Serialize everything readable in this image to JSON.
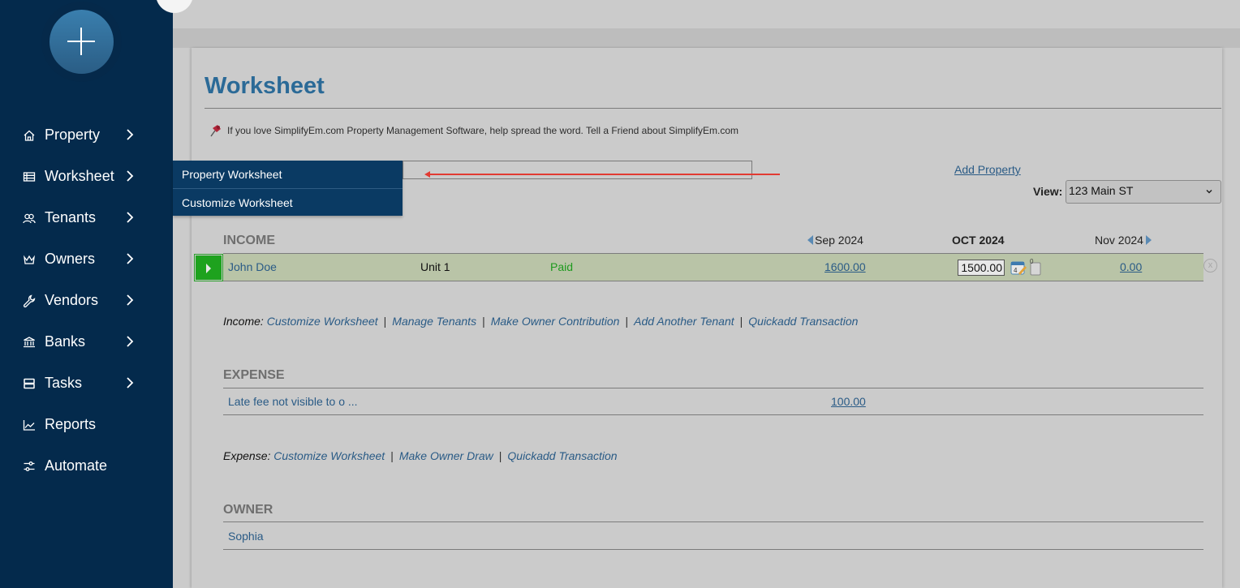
{
  "sidebar": {
    "fab_label": "add",
    "items": [
      {
        "label": "Property",
        "icon": "home-icon",
        "has_submenu": true
      },
      {
        "label": "Worksheet",
        "icon": "table-icon",
        "has_submenu": true
      },
      {
        "label": "Tenants",
        "icon": "users-icon",
        "has_submenu": true
      },
      {
        "label": "Owners",
        "icon": "crown-icon",
        "has_submenu": true
      },
      {
        "label": "Vendors",
        "icon": "wrench-icon",
        "has_submenu": true
      },
      {
        "label": "Banks",
        "icon": "bank-icon",
        "has_submenu": true
      },
      {
        "label": "Tasks",
        "icon": "tasks-icon",
        "has_submenu": true
      },
      {
        "label": "Reports",
        "icon": "chart-icon",
        "has_submenu": false
      },
      {
        "label": "Automate",
        "icon": "sliders-icon",
        "has_submenu": false
      }
    ]
  },
  "submenu": {
    "items": [
      "Property Worksheet",
      "Customize Worksheet"
    ]
  },
  "page": {
    "title": "Worksheet",
    "promo": "If you love SimplifyEm.com Property Management Software, help spread the word. Tell a Friend about SimplifyEm.com",
    "add_property": "Add Property",
    "view_label": "View:",
    "view_value": "123 Main ST"
  },
  "income": {
    "title": "INCOME",
    "months": {
      "prev": "Sep 2024",
      "current": "OCT 2024",
      "next": "Nov 2024"
    },
    "rows": [
      {
        "name": "John Doe",
        "unit": "Unit 1",
        "status": "Paid",
        "prev": "1600.00",
        "current": "1500.00",
        "next": "0.00",
        "attachments": "0"
      }
    ],
    "actions_label": "Income:",
    "actions": [
      "Customize Worksheet",
      "Manage Tenants",
      "Make Owner Contribution",
      "Add Another Tenant",
      "Quickadd Transaction"
    ]
  },
  "expense": {
    "title": "EXPENSE",
    "rows": [
      {
        "name": "Late fee not visible to o ...",
        "prev": "100.00"
      }
    ],
    "actions_label": "Expense:",
    "actions": [
      "Customize Worksheet",
      "Make Owner Draw",
      "Quickadd Transaction"
    ]
  },
  "owner": {
    "title": "OWNER",
    "rows": [
      {
        "name": "Sophia"
      }
    ]
  },
  "colors": {
    "sidebar_bg": "#042a4c",
    "submenu_bg": "#0a3a63",
    "title": "#2b6a97",
    "link": "#2a5b86",
    "paid": "#1e9a1e",
    "row_highlight": "#b9c4a7",
    "arrow": "#e23a32"
  }
}
